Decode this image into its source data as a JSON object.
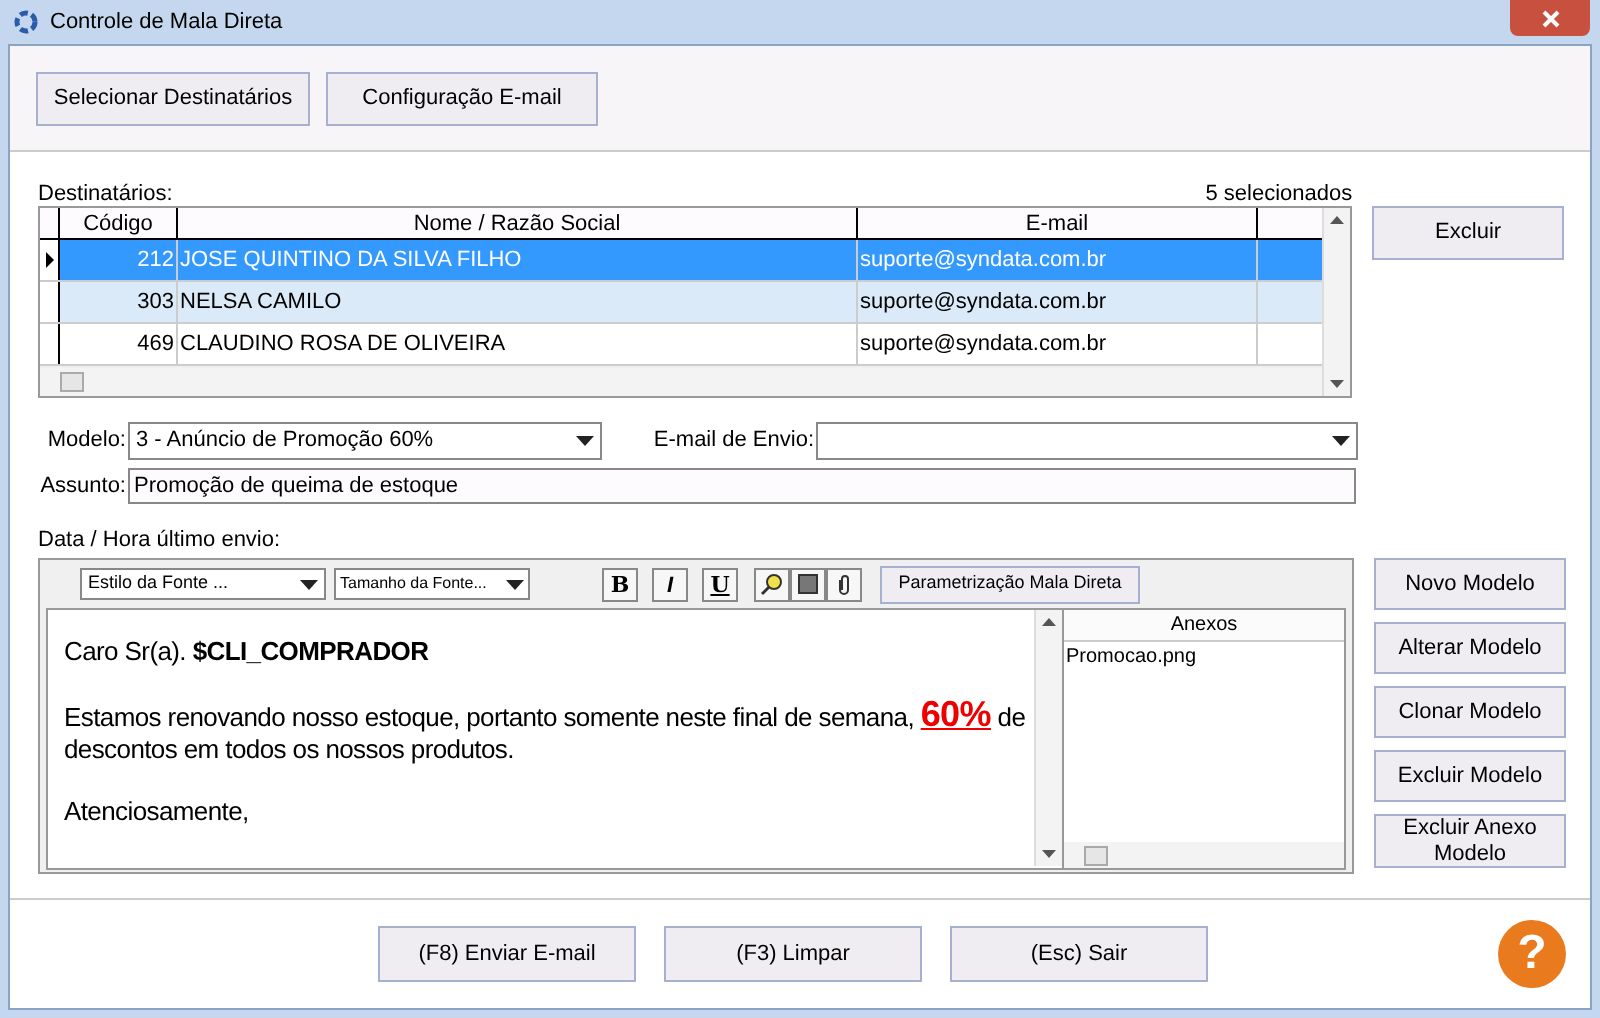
{
  "window": {
    "title": "Controle de Mala Direta"
  },
  "top_buttons": [
    "Selecionar Destinatários",
    "Configuração E-mail"
  ],
  "recipients": {
    "label": "Destinatários:",
    "count": "5 selecionados",
    "columns": [
      "Código",
      "Nome / Razão Social",
      "E-mail"
    ],
    "rows": [
      {
        "code": "212",
        "name": "JOSE QUINTINO DA SILVA FILHO",
        "email": "suporte@syndata.com.br",
        "selected": true,
        "current": true
      },
      {
        "code": "303",
        "name": "NELSA CAMILO",
        "email": "suporte@syndata.com.br",
        "selected": false,
        "current": false
      },
      {
        "code": "469",
        "name": "CLAUDINO ROSA DE OLIVEIRA",
        "email": "suporte@syndata.com.br",
        "selected": false,
        "current": false
      }
    ]
  },
  "delete_button": "Excluir",
  "form": {
    "model_label": "Modelo:",
    "model_value": "3 - Anúncio de Promoção 60%",
    "sender_label": "E-mail de Envio:",
    "subject_label": "Assunto:",
    "subject_value": "Promoção de queima de estoque",
    "last_send_label": "Data / Hora último envio:"
  },
  "editor": {
    "font_style": "Estilo da Fonte ...",
    "font_size": "Tamanho da Fonte...",
    "format_buttons": [
      "B",
      "I",
      "U"
    ],
    "param_button": "Parametrização Mala Direta",
    "paragraphs": [
      [
        {
          "text": "Caro Sr(a). **$CLI_COMPRADOR**",
          "kind": "plain"
        }
      ],
      [
        {
          "text": "Estamos renovando nosso estoque, portanto somente neste final de semana, ",
          "kind": "plain"
        },
        {
          "text": "60%",
          "kind": "highlight"
        },
        {
          "text": " de descontos em todos os nossos produtos.",
          "kind": "plain"
        }
      ],
      [
        {
          "text": "Atenciosamente,",
          "kind": "plain"
        }
      ]
    ]
  },
  "attachments": {
    "title": "Anexos",
    "items": [
      "Promocao.png"
    ]
  },
  "model_buttons": [
    "Novo Modelo",
    "Alterar Modelo",
    "Clonar Modelo",
    "Excluir Modelo",
    "Excluir Anexo Modelo"
  ],
  "bottom_buttons": [
    "(F8) Enviar E-mail",
    "(F3) Limpar",
    "(Esc) Sair"
  ],
  "help": "?"
}
